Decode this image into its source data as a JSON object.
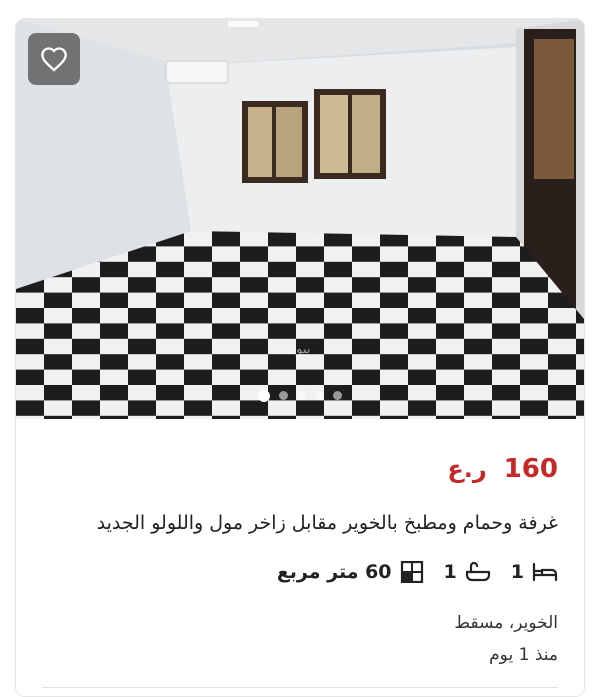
{
  "listing": {
    "price_value": "160",
    "price_currency": "ر.ع",
    "title": "غرفة وحمام ومطبخ بالخوير مقابل زاخر مول واللولو الجديد",
    "bedrooms": "1",
    "bathrooms": "1",
    "area": "60 متر مربع",
    "location": "الخوير، مسقط",
    "posted": "منذ 1 يوم",
    "image_count": 5,
    "active_image": 1,
    "watermark": "بيوت"
  },
  "icons": {
    "favorite": "heart-outline-icon",
    "bed": "bed-icon",
    "bath": "bathtub-icon",
    "area": "area-grid-icon"
  },
  "colors": {
    "price": "#c62828",
    "text": "#222222",
    "fav_bg": "#464646"
  }
}
